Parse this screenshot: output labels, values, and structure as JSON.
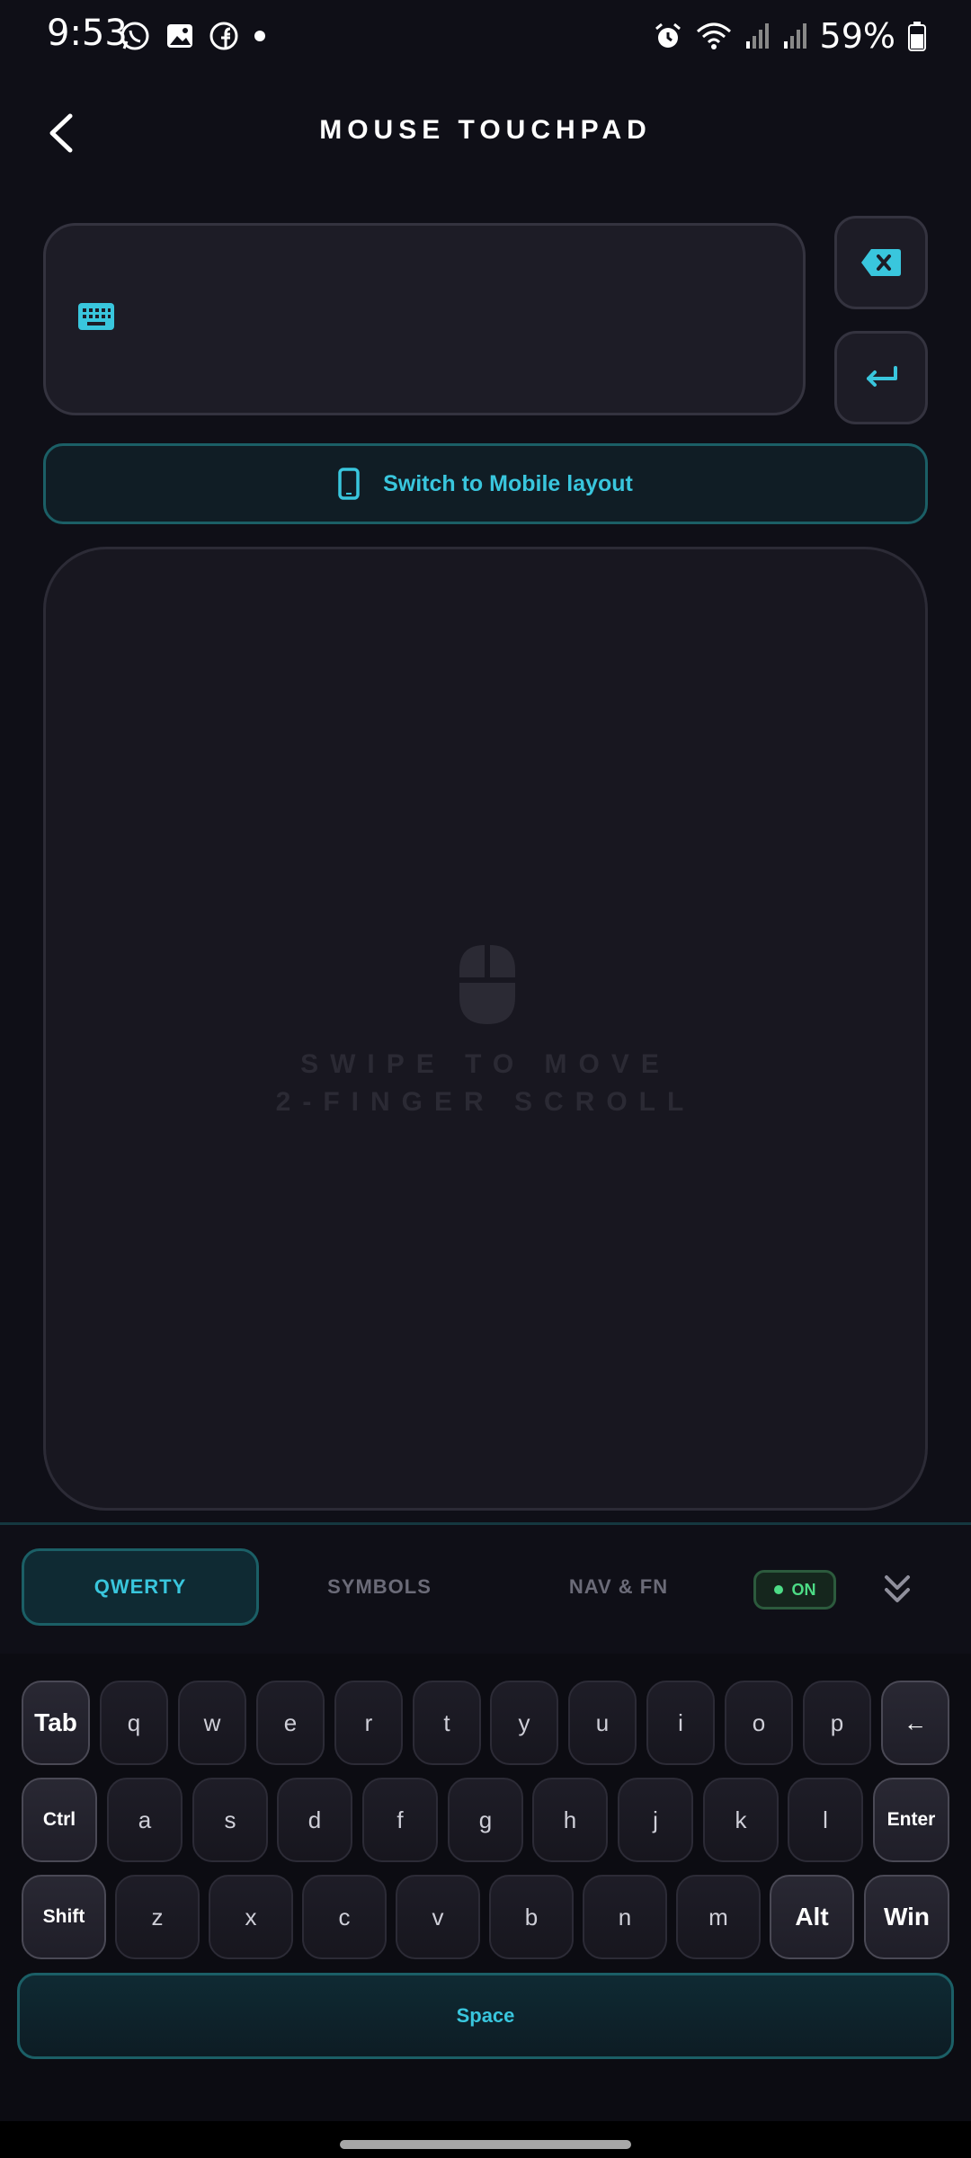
{
  "status_bar": {
    "time": "9:53",
    "battery": "59%",
    "left_icons": [
      "whatsapp-icon",
      "gallery-icon",
      "facebook-icon",
      "dot-icon"
    ],
    "right_icons": [
      "alarm-icon",
      "wifi-icon",
      "signal-icon",
      "signal-icon",
      "battery-icon"
    ]
  },
  "header": {
    "title": "MOUSE TOUCHPAD",
    "back_icon": "chevron-left-icon"
  },
  "input": {
    "value": "",
    "icon": "keyboard-icon"
  },
  "side_buttons": {
    "backspace_icon": "backspace-icon",
    "enter_icon": "enter-arrow-icon"
  },
  "switch_layout": {
    "label": "Switch to Mobile layout",
    "icon": "phone-icon"
  },
  "touchpad": {
    "hint_line1": "SWIPE TO MOVE",
    "hint_line2": "2-FINGER SCROLL",
    "icon": "mouse-icon"
  },
  "tabs": {
    "items": [
      {
        "label": "QWERTY",
        "active": true
      },
      {
        "label": "SYMBOLS",
        "active": false
      },
      {
        "label": "NAV & FN",
        "active": false
      }
    ],
    "toggle_label": "ON",
    "collapse_icon": "double-chevron-down-icon"
  },
  "keyboard": {
    "row1": [
      "Tab",
      "q",
      "w",
      "e",
      "r",
      "t",
      "y",
      "u",
      "i",
      "o",
      "p",
      "←"
    ],
    "row2": [
      "Ctrl",
      "a",
      "s",
      "d",
      "f",
      "g",
      "h",
      "j",
      "k",
      "l",
      "Enter"
    ],
    "row3": [
      "Shift",
      "z",
      "x",
      "c",
      "v",
      "b",
      "n",
      "m",
      "Alt",
      "Win"
    ],
    "space": "Space"
  },
  "colors": {
    "accent": "#39c6dd",
    "background": "#0f0f17",
    "toggle_on": "#4ddc86"
  }
}
